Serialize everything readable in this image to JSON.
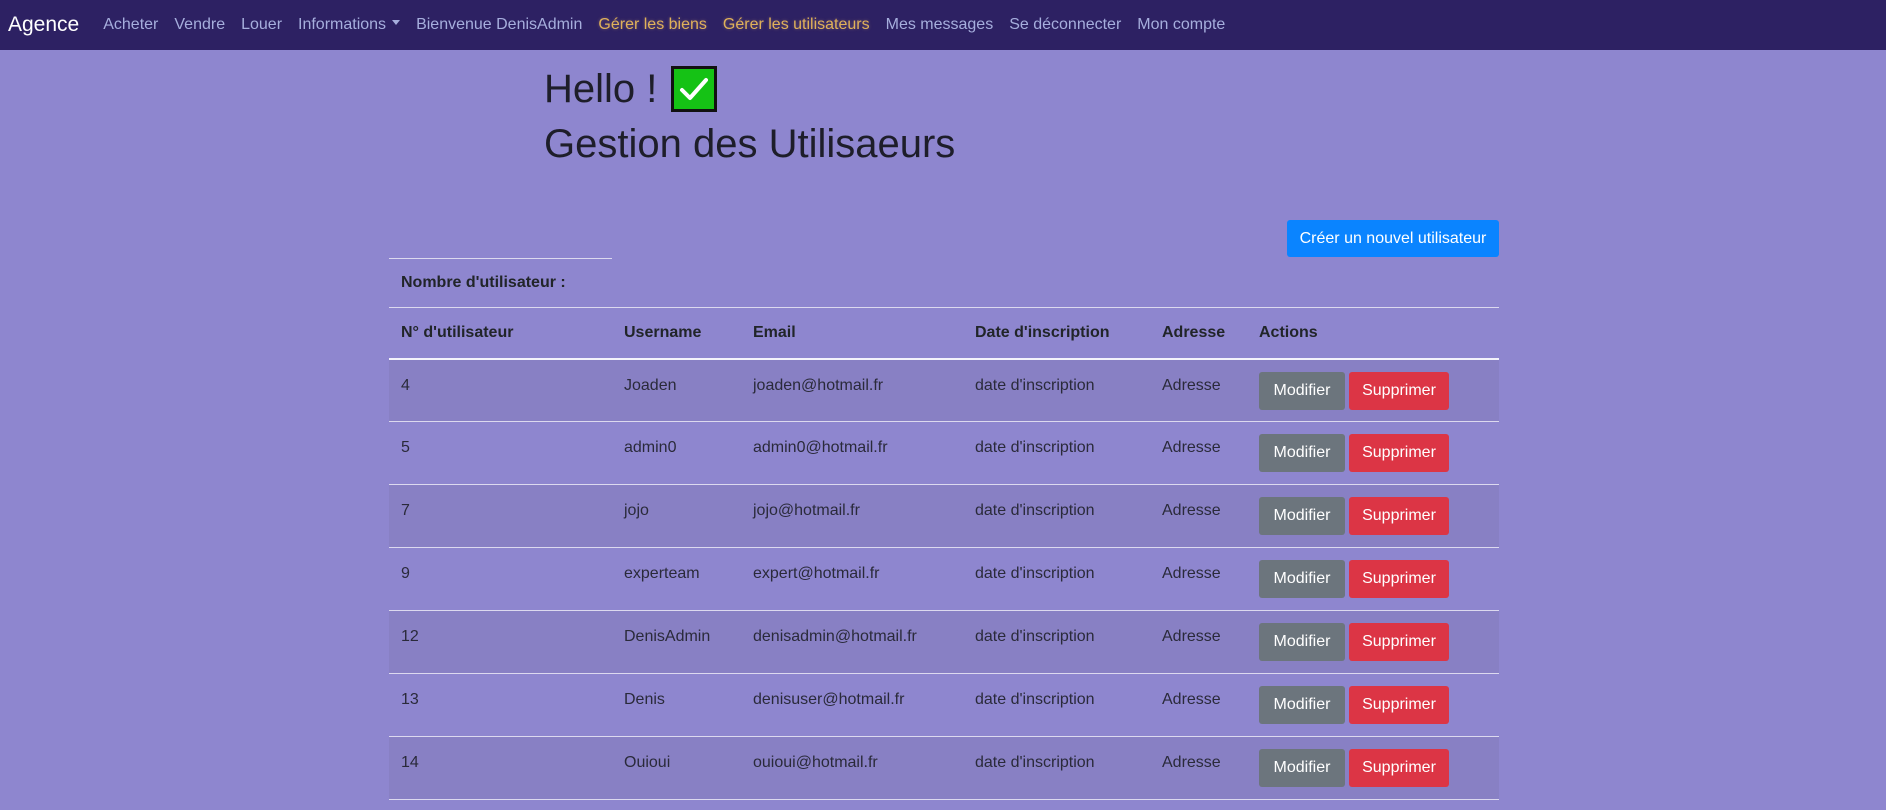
{
  "navbar": {
    "brand": "Agence",
    "links": [
      {
        "label": "Acheter",
        "highlight": false
      },
      {
        "label": "Vendre",
        "highlight": false
      },
      {
        "label": "Louer",
        "highlight": false
      },
      {
        "label": "Informations",
        "highlight": false,
        "dropdown": true
      },
      {
        "label": "Bienvenue DenisAdmin",
        "highlight": false
      },
      {
        "label": "Gérer les biens",
        "highlight": true
      },
      {
        "label": "Gérer les utilisateurs",
        "highlight": true
      },
      {
        "label": "Mes messages",
        "highlight": false
      },
      {
        "label": "Se déconnecter",
        "highlight": false
      },
      {
        "label": "Mon compte",
        "highlight": false
      }
    ]
  },
  "header": {
    "greeting": "Hello !",
    "title": "Gestion des Utilisaeurs"
  },
  "toolbar": {
    "create_label": "Créer un nouvel utilisateur"
  },
  "count": {
    "label": "Nombre d'utilisateur :"
  },
  "table": {
    "columns": [
      "N° d'utilisateur",
      "Username",
      "Email",
      "Date d'inscription",
      "Adresse",
      "Actions"
    ],
    "rows": [
      {
        "id": "4",
        "username": "Joaden",
        "email": "joaden@hotmail.fr",
        "date": "date d'inscription",
        "address": "Adresse"
      },
      {
        "id": "5",
        "username": "admin0",
        "email": "admin0@hotmail.fr",
        "date": "date d'inscription",
        "address": "Adresse"
      },
      {
        "id": "7",
        "username": "jojo",
        "email": "jojo@hotmail.fr",
        "date": "date d'inscription",
        "address": "Adresse"
      },
      {
        "id": "9",
        "username": "experteam",
        "email": "expert@hotmail.fr",
        "date": "date d'inscription",
        "address": "Adresse"
      },
      {
        "id": "12",
        "username": "DenisAdmin",
        "email": "denisadmin@hotmail.fr",
        "date": "date d'inscription",
        "address": "Adresse"
      },
      {
        "id": "13",
        "username": "Denis",
        "email": "denisuser@hotmail.fr",
        "date": "date d'inscription",
        "address": "Adresse"
      },
      {
        "id": "14",
        "username": "Ouioui",
        "email": "ouioui@hotmail.fr",
        "date": "date d'inscription",
        "address": "Adresse"
      }
    ],
    "modify_label": "Modifier",
    "delete_label": "Supprimer"
  },
  "icons": {
    "check": "check-icon"
  },
  "colors": {
    "background": "#8e86cf",
    "navbar": "#2d2163",
    "primary": "#0a84ff",
    "secondary": "#6c757d",
    "danger": "#dc3545",
    "highlight_link": "#e0b15a",
    "check_green": "#15c215"
  }
}
